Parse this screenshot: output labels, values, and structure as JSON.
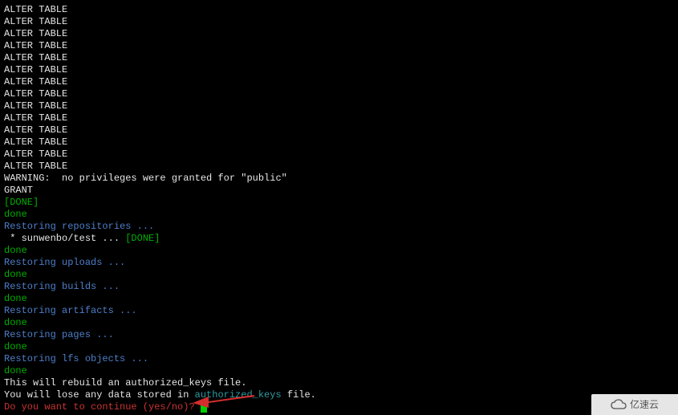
{
  "lines": [
    {
      "cls": "white",
      "text": "ALTER TABLE"
    },
    {
      "cls": "white",
      "text": "ALTER TABLE"
    },
    {
      "cls": "white",
      "text": "ALTER TABLE"
    },
    {
      "cls": "white",
      "text": "ALTER TABLE"
    },
    {
      "cls": "white",
      "text": "ALTER TABLE"
    },
    {
      "cls": "white",
      "text": "ALTER TABLE"
    },
    {
      "cls": "white",
      "text": "ALTER TABLE"
    },
    {
      "cls": "white",
      "text": "ALTER TABLE"
    },
    {
      "cls": "white",
      "text": "ALTER TABLE"
    },
    {
      "cls": "white",
      "text": "ALTER TABLE"
    },
    {
      "cls": "white",
      "text": "ALTER TABLE"
    },
    {
      "cls": "white",
      "text": "ALTER TABLE"
    },
    {
      "cls": "white",
      "text": "ALTER TABLE"
    },
    {
      "cls": "white",
      "text": "ALTER TABLE"
    },
    {
      "cls": "white",
      "text": "WARNING:  no privileges were granted for \"public\""
    },
    {
      "cls": "white",
      "text": "GRANT"
    },
    {
      "cls": "green",
      "text": "[DONE]"
    },
    {
      "cls": "green",
      "text": "done"
    },
    {
      "cls": "blue",
      "text": "Restoring repositories ..."
    },
    {
      "cls": "mixed",
      "segments": [
        {
          "cls": "white",
          "text": " * sunwenbo/test ... "
        },
        {
          "cls": "green",
          "text": "[DONE]"
        }
      ]
    },
    {
      "cls": "green",
      "text": "done"
    },
    {
      "cls": "blue",
      "text": "Restoring uploads ..."
    },
    {
      "cls": "green",
      "text": "done"
    },
    {
      "cls": "blue",
      "text": "Restoring builds ..."
    },
    {
      "cls": "green",
      "text": "done"
    },
    {
      "cls": "blue",
      "text": "Restoring artifacts ..."
    },
    {
      "cls": "green",
      "text": "done"
    },
    {
      "cls": "blue",
      "text": "Restoring pages ..."
    },
    {
      "cls": "green",
      "text": "done"
    },
    {
      "cls": "blue",
      "text": "Restoring lfs objects ..."
    },
    {
      "cls": "green",
      "text": "done"
    },
    {
      "cls": "white",
      "text": "This will rebuild an authorized_keys file."
    },
    {
      "cls": "mixed",
      "segments": [
        {
          "cls": "white",
          "text": "You will lose any data stored in "
        },
        {
          "cls": "cyan",
          "text": "authorized_keys"
        },
        {
          "cls": "white",
          "text": " file."
        }
      ]
    },
    {
      "cls": "prompt",
      "segments": [
        {
          "cls": "red",
          "text": "Do you want to continue (yes/no)?"
        },
        {
          "cls": "white",
          "text": " "
        }
      ]
    }
  ],
  "watermark_text": "亿速云"
}
